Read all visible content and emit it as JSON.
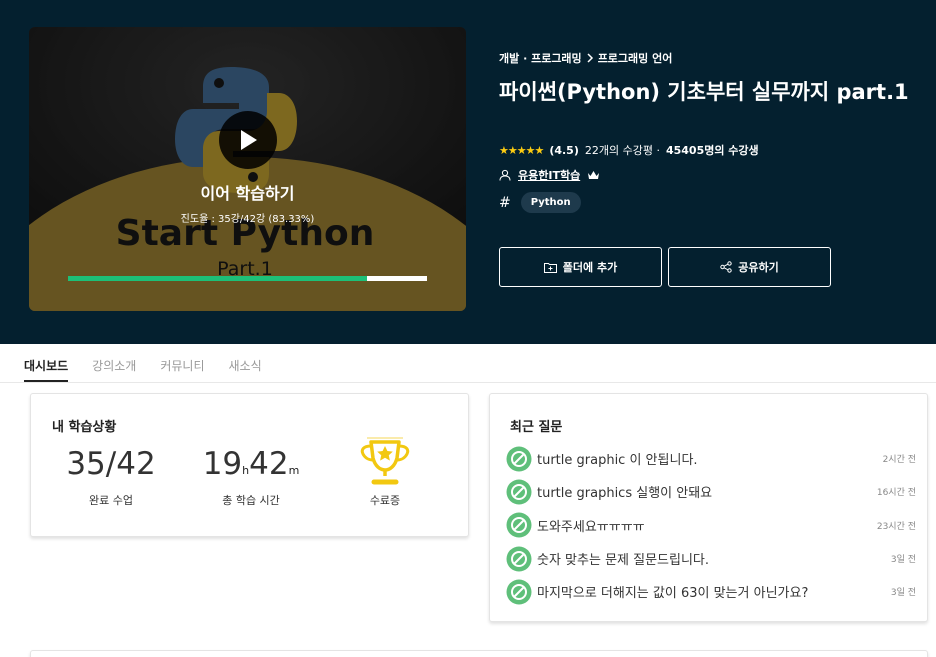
{
  "thumbnail": {
    "art_title": "Start Python",
    "art_subtitle": "Part.1",
    "resume_label": "이어 학습하기",
    "progress_text": "진도율 : 35강/42강 (83.33%)",
    "progress": 0.8333
  },
  "course": {
    "breadcrumb": [
      "개발 · 프로그래밍",
      "프로그래밍 언어"
    ],
    "title": "파이썬(Python) 기초부터 실무까지 part.1",
    "stars": "★★★★★",
    "rating": "(4.5)",
    "review_count": "22개의 수강평 ·",
    "students": "45405명의 수강생",
    "instructor": "유용한IT학습",
    "tag": "Python"
  },
  "actions": {
    "folder": "폴더에 추가",
    "share": "공유하기"
  },
  "tabs": [
    "대시보드",
    "강의소개",
    "커뮤니티",
    "새소식"
  ],
  "status": {
    "title": "내 학습상황",
    "completed": "35/42",
    "completed_label": "완료 수업",
    "hours": "19",
    "hours_unit": "h",
    "minutes": "42",
    "minutes_unit": "m",
    "time_label": "총 학습 시간",
    "certificate_label": "수료증"
  },
  "questions": {
    "title": "최근 질문",
    "items": [
      {
        "text": "turtle graphic 이 안됩니다.",
        "time": "2시간 전"
      },
      {
        "text": "turtle graphics 실행이 안돼요",
        "time": "16시간 전"
      },
      {
        "text": "도와주세요ㅠㅠㅠㅠ",
        "time": "23시간 전"
      },
      {
        "text": "숫자 맞추는 문제 질문드립니다.",
        "time": "3일 전"
      },
      {
        "text": "마지막으로 더해지는 값이 63이 맞는거 아닌가요?",
        "time": "3일 전"
      }
    ]
  },
  "colors": {
    "hero_bg": "#04202f",
    "progress": "#1dc078",
    "star": "#fdcc11",
    "question_icon": "#5fbf7a",
    "trophy": "#f2c811"
  }
}
